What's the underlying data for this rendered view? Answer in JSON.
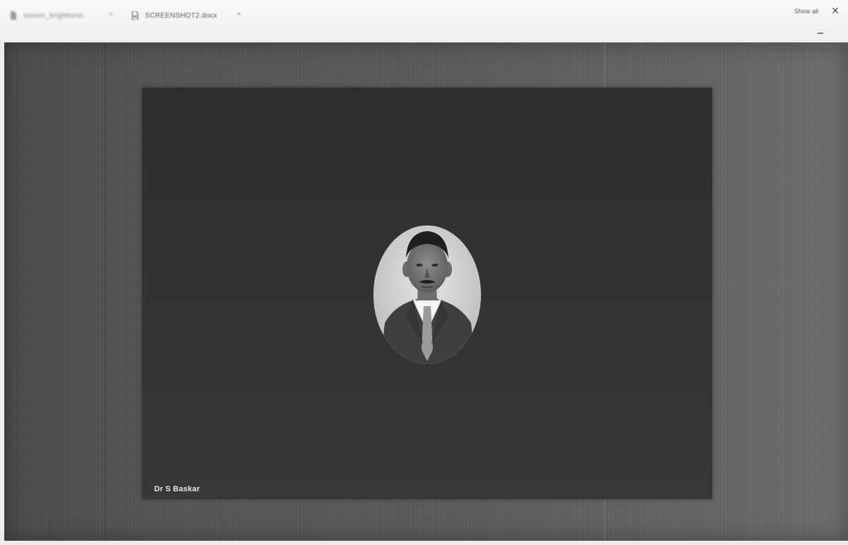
{
  "download_bar": {
    "items": [
      {
        "name": "screen_brightness",
        "icon": "file-icon"
      },
      {
        "name": "SCREENSHOT2.docx",
        "icon": "word-doc-icon"
      }
    ],
    "show_all_label": "Show all",
    "close_icon": "close-icon"
  },
  "meeting": {
    "participant_name": "Dr S Baskar",
    "avatar_icon": "participant-avatar-photo"
  },
  "colors": {
    "tile_background": "#2f2f2f",
    "screen_background": "#595959",
    "download_bar_background": "#f3f3f3"
  }
}
